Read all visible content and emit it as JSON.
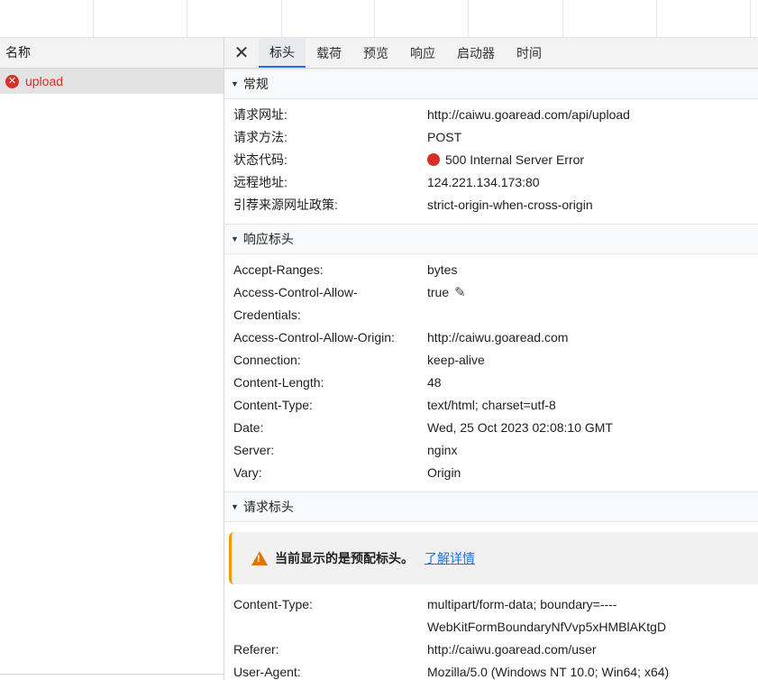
{
  "left_panel": {
    "header": "名称",
    "requests": [
      {
        "name": "upload"
      }
    ]
  },
  "tabs": [
    "标头",
    "载荷",
    "预览",
    "响应",
    "启动器",
    "时间"
  ],
  "close_glyph": "✕",
  "general": {
    "title": "常规",
    "rows": [
      {
        "key": "请求网址:",
        "value": "http://caiwu.goaread.com/api/upload"
      },
      {
        "key": "请求方法:",
        "value": "POST"
      },
      {
        "key": "状态代码:",
        "value": "500 Internal Server Error"
      },
      {
        "key": "远程地址:",
        "value": "124.221.134.173:80"
      },
      {
        "key": "引荐来源网址政策:",
        "value": "strict-origin-when-cross-origin"
      }
    ]
  },
  "response_headers": {
    "title": "响应标头",
    "rows": [
      {
        "key": "Accept-Ranges:",
        "value": "bytes"
      },
      {
        "key": "Access-Control-Allow-",
        "key2": "Credentials:",
        "value": "true"
      },
      {
        "key": "Access-Control-Allow-Origin:",
        "value": "http://caiwu.goaread.com"
      },
      {
        "key": "Connection:",
        "value": "keep-alive"
      },
      {
        "key": "Content-Length:",
        "value": "48"
      },
      {
        "key": "Content-Type:",
        "value": "text/html; charset=utf-8"
      },
      {
        "key": "Date:",
        "value": "Wed, 25 Oct 2023 02:08:10 GMT"
      },
      {
        "key": "Server:",
        "value": "nginx"
      },
      {
        "key": "Vary:",
        "value": "Origin"
      }
    ]
  },
  "request_headers": {
    "title": "请求标头",
    "warning": "当前显示的是预配标头。",
    "warning_link": "了解详情",
    "rows": [
      {
        "key": "Content-Type:",
        "value": "multipart/form-data; boundary=----",
        "value2": "WebKitFormBoundaryNfVvp5xHMBlAKtgD"
      },
      {
        "key": "Referer:",
        "value": "http://caiwu.goaread.com/user"
      },
      {
        "key": "User-Agent:",
        "value": "Mozilla/5.0 (Windows NT 10.0; Win64; x64)"
      }
    ]
  },
  "colors": {
    "error_red": "#d93025",
    "accent_blue": "#1a73e8",
    "warning_orange": "#e37400"
  },
  "icons": [
    "error-icon",
    "close-icon",
    "triangle-down-icon",
    "red-dot-icon",
    "pencil-icon",
    "warning-icon"
  ]
}
